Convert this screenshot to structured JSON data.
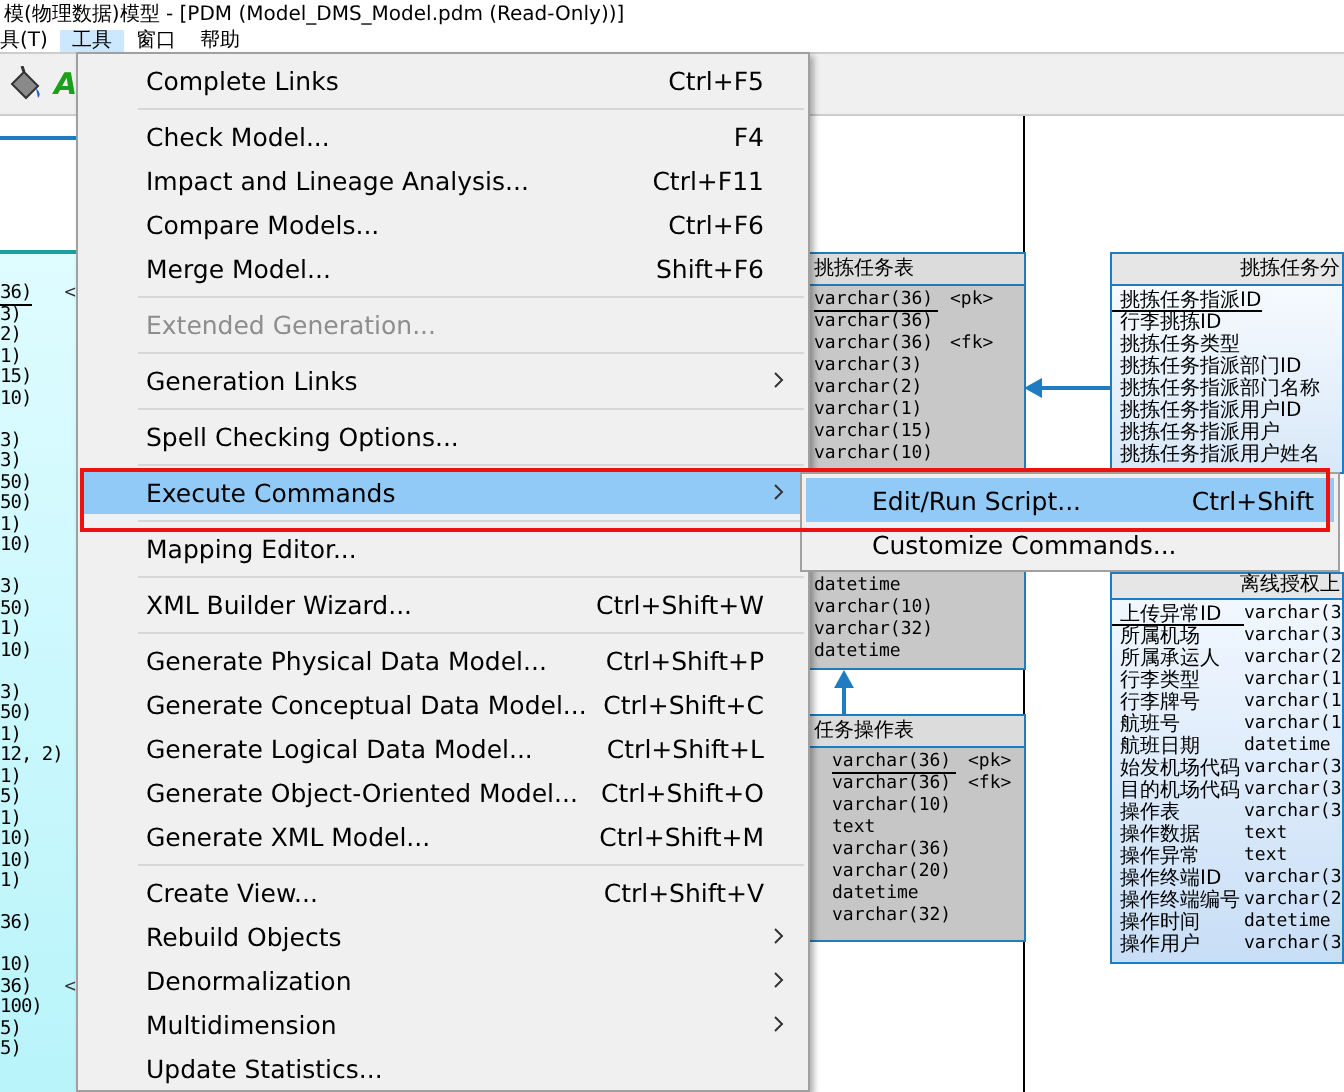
{
  "window": {
    "title": "模(物理数据)模型 - [PDM (Model_DMS_Model.pdm (Read-Only))]"
  },
  "menu_bar": [
    {
      "label": "具(T)",
      "selected": false
    },
    {
      "label": "工具",
      "selected": true
    },
    {
      "label": "窗口",
      "selected": false
    },
    {
      "label": "帮助",
      "selected": false
    }
  ],
  "toolbar": {
    "glyph": "A"
  },
  "menu": {
    "items": [
      {
        "kind": "item",
        "label": "Complete Links",
        "shortcut": "Ctrl+F5",
        "has_submenu": false,
        "disabled": false,
        "selected": false
      },
      {
        "kind": "separator"
      },
      {
        "kind": "item",
        "label": "Check Model...",
        "shortcut": "F4",
        "has_submenu": false,
        "disabled": false,
        "selected": false
      },
      {
        "kind": "item",
        "label": "Impact and Lineage Analysis...",
        "shortcut": "Ctrl+F11",
        "has_submenu": false,
        "disabled": false,
        "selected": false
      },
      {
        "kind": "item",
        "label": "Compare Models...",
        "shortcut": "Ctrl+F6",
        "has_submenu": false,
        "disabled": false,
        "selected": false
      },
      {
        "kind": "item",
        "label": "Merge Model...",
        "shortcut": "Shift+F6",
        "has_submenu": false,
        "disabled": false,
        "selected": false
      },
      {
        "kind": "separator"
      },
      {
        "kind": "item",
        "label": "Extended Generation...",
        "has_submenu": false,
        "disabled": true,
        "selected": false
      },
      {
        "kind": "separator"
      },
      {
        "kind": "item",
        "label": "Generation Links",
        "has_submenu": true,
        "disabled": false,
        "selected": false
      },
      {
        "kind": "separator"
      },
      {
        "kind": "item",
        "label": "Spell Checking Options...",
        "has_submenu": false,
        "disabled": false,
        "selected": false
      },
      {
        "kind": "separator"
      },
      {
        "kind": "item",
        "label": "Execute Commands",
        "has_submenu": true,
        "disabled": false,
        "selected": true
      },
      {
        "kind": "separator"
      },
      {
        "kind": "item",
        "label": "Mapping Editor...",
        "has_submenu": false,
        "disabled": false,
        "selected": false
      },
      {
        "kind": "separator"
      },
      {
        "kind": "item",
        "label": "XML Builder Wizard...",
        "shortcut": "Ctrl+Shift+W",
        "has_submenu": false,
        "disabled": false,
        "selected": false
      },
      {
        "kind": "separator"
      },
      {
        "kind": "item",
        "label": "Generate Physical Data Model...",
        "shortcut": "Ctrl+Shift+P",
        "has_submenu": false,
        "disabled": false,
        "selected": false
      },
      {
        "kind": "item",
        "label": "Generate Conceptual Data Model...",
        "shortcut": "Ctrl+Shift+C",
        "has_submenu": false,
        "disabled": false,
        "selected": false
      },
      {
        "kind": "item",
        "label": "Generate Logical Data Model...",
        "shortcut": "Ctrl+Shift+L",
        "has_submenu": false,
        "disabled": false,
        "selected": false
      },
      {
        "kind": "item",
        "label": "Generate Object-Oriented Model...",
        "shortcut": "Ctrl+Shift+O",
        "has_submenu": false,
        "disabled": false,
        "selected": false
      },
      {
        "kind": "item",
        "label": "Generate XML Model...",
        "shortcut": "Ctrl+Shift+M",
        "has_submenu": false,
        "disabled": false,
        "selected": false
      },
      {
        "kind": "separator"
      },
      {
        "kind": "item",
        "label": "Create View...",
        "shortcut": "Ctrl+Shift+V",
        "has_submenu": false,
        "disabled": false,
        "selected": false
      },
      {
        "kind": "item",
        "label": "Rebuild Objects",
        "has_submenu": true,
        "disabled": false,
        "selected": false
      },
      {
        "kind": "item",
        "label": "Denormalization",
        "has_submenu": true,
        "disabled": false,
        "selected": false
      },
      {
        "kind": "item",
        "label": "Multidimension",
        "has_submenu": true,
        "disabled": false,
        "selected": false
      },
      {
        "kind": "item",
        "label": "Update Statistics...",
        "has_submenu": false,
        "disabled": false,
        "selected": false
      }
    ]
  },
  "submenu": {
    "items": [
      {
        "label": "Edit/Run Script...",
        "shortcut": "Ctrl+Shift",
        "selected": true
      },
      {
        "label": "Customize Commands...",
        "selected": false
      }
    ]
  },
  "annotation": {
    "kind": "rectangle"
  },
  "diagram": {
    "partial_table": {
      "rows": [
        {
          "kind": "value",
          "text": "36)",
          "primary_key": true,
          "marker": "<"
        },
        {
          "kind": "value",
          "text": "3)",
          "primary_key": false
        },
        {
          "kind": "value",
          "text": "2)",
          "primary_key": false
        },
        {
          "kind": "value",
          "text": "1)",
          "primary_key": false
        },
        {
          "kind": "value",
          "text": "15)",
          "primary_key": false
        },
        {
          "kind": "value",
          "text": "10)",
          "primary_key": false
        },
        {
          "kind": "blank"
        },
        {
          "kind": "value",
          "text": "3)",
          "primary_key": false
        },
        {
          "kind": "value",
          "text": "3)",
          "primary_key": false
        },
        {
          "kind": "value",
          "text": "50)",
          "primary_key": false
        },
        {
          "kind": "value",
          "text": "50)",
          "primary_key": false
        },
        {
          "kind": "value",
          "text": "1)",
          "primary_key": false
        },
        {
          "kind": "value",
          "text": "10)",
          "primary_key": false
        },
        {
          "kind": "blank"
        },
        {
          "kind": "value",
          "text": "3)",
          "primary_key": false
        },
        {
          "kind": "value",
          "text": "50)",
          "primary_key": false
        },
        {
          "kind": "value",
          "text": "1)",
          "primary_key": false
        },
        {
          "kind": "value",
          "text": "10)",
          "primary_key": false
        },
        {
          "kind": "blank"
        },
        {
          "kind": "value",
          "text": "3)",
          "primary_key": false
        },
        {
          "kind": "value",
          "text": "50)",
          "primary_key": false
        },
        {
          "kind": "value",
          "text": "1)",
          "primary_key": false
        },
        {
          "kind": "value",
          "text": "12, 2)",
          "primary_key": false
        },
        {
          "kind": "value",
          "text": "1)",
          "primary_key": false
        },
        {
          "kind": "value",
          "text": "5)",
          "primary_key": false
        },
        {
          "kind": "value",
          "text": "1)",
          "primary_key": false
        },
        {
          "kind": "value",
          "text": "10)",
          "primary_key": false
        },
        {
          "kind": "value",
          "text": "10)",
          "primary_key": false
        },
        {
          "kind": "value",
          "text": "1)",
          "primary_key": false
        },
        {
          "kind": "blank"
        },
        {
          "kind": "value",
          "text": "36)",
          "primary_key": false
        },
        {
          "kind": "blank"
        },
        {
          "kind": "value",
          "text": "10)",
          "primary_key": false
        },
        {
          "kind": "value",
          "text": "36)",
          "primary_key": false,
          "marker": "<"
        },
        {
          "kind": "value",
          "text": "100)",
          "primary_key": false
        },
        {
          "kind": "value",
          "text": "5)",
          "primary_key": false
        },
        {
          "kind": "value",
          "text": "5)",
          "primary_key": false
        }
      ]
    },
    "tables": [
      {
        "title": "挑拣任务表",
        "rows": [
          {
            "kind": "value",
            "type": "varchar(36)",
            "key_label": "<pk>",
            "primary_key": true
          },
          {
            "kind": "value",
            "type": "varchar(36)",
            "primary_key": false
          },
          {
            "kind": "value",
            "type": "varchar(36)",
            "key_label": "<fk>",
            "primary_key": false
          },
          {
            "kind": "value",
            "type": "varchar(3)",
            "primary_key": false
          },
          {
            "kind": "value",
            "type": "varchar(2)",
            "primary_key": false
          },
          {
            "kind": "value",
            "type": "varchar(1)",
            "primary_key": false
          },
          {
            "kind": "value",
            "type": "varchar(15)",
            "primary_key": false
          },
          {
            "kind": "value",
            "type": "varchar(10)",
            "primary_key": false
          },
          {
            "kind": "covered"
          },
          {
            "kind": "covered"
          },
          {
            "kind": "covered"
          },
          {
            "kind": "covered"
          },
          {
            "kind": "covered"
          },
          {
            "kind": "value",
            "type": "datetime",
            "primary_key": false
          },
          {
            "kind": "value",
            "type": "varchar(10)",
            "primary_key": false
          },
          {
            "kind": "value",
            "type": "varchar(32)",
            "primary_key": false
          },
          {
            "kind": "value",
            "type": "datetime",
            "primary_key": false
          }
        ]
      },
      {
        "title": "挑拣任务分",
        "rows": [
          {
            "kind": "value",
            "name": "挑拣任务指派ID",
            "primary_key": true
          },
          {
            "kind": "value",
            "name": "行李挑拣ID",
            "primary_key": false
          },
          {
            "kind": "value",
            "name": "挑拣任务类型",
            "primary_key": false
          },
          {
            "kind": "value",
            "name": "挑拣任务指派部门ID",
            "primary_key": false
          },
          {
            "kind": "value",
            "name": "挑拣任务指派部门名称",
            "primary_key": false
          },
          {
            "kind": "value",
            "name": "挑拣任务指派用户ID",
            "primary_key": false
          },
          {
            "kind": "value",
            "name": "挑拣任务指派用户",
            "primary_key": false
          },
          {
            "kind": "value",
            "name": "挑拣任务指派用户姓名",
            "primary_key": false
          }
        ]
      },
      {
        "title": "离线授权上",
        "rows": [
          {
            "kind": "value",
            "name": "上传异常ID",
            "type": "varchar(3",
            "primary_key": true
          },
          {
            "kind": "value",
            "name": "所属机场",
            "type": "varchar(3",
            "primary_key": false
          },
          {
            "kind": "value",
            "name": "所属承运人",
            "type": "varchar(2",
            "primary_key": false
          },
          {
            "kind": "value",
            "name": "行李类型",
            "type": "varchar(1",
            "primary_key": false
          },
          {
            "kind": "value",
            "name": "行李牌号",
            "type": "varchar(1",
            "primary_key": false
          },
          {
            "kind": "value",
            "name": "航班号",
            "type": "varchar(1",
            "primary_key": false
          },
          {
            "kind": "value",
            "name": "航班日期",
            "type": "datetime",
            "primary_key": false
          },
          {
            "kind": "value",
            "name": "始发机场代码",
            "type": "varchar(3",
            "primary_key": false
          },
          {
            "kind": "value",
            "name": "目的机场代码",
            "type": "varchar(3",
            "primary_key": false
          },
          {
            "kind": "value",
            "name": "操作表",
            "type": "varchar(3",
            "primary_key": false
          },
          {
            "kind": "value",
            "name": "操作数据",
            "type": "text",
            "primary_key": false
          },
          {
            "kind": "value",
            "name": "操作异常",
            "type": "text",
            "primary_key": false
          },
          {
            "kind": "value",
            "name": "操作终端ID",
            "type": "varchar(3",
            "primary_key": false
          },
          {
            "kind": "value",
            "name": "操作终端编号",
            "type": "varchar(2",
            "primary_key": false
          },
          {
            "kind": "value",
            "name": "操作时间",
            "type": "datetime",
            "primary_key": false
          },
          {
            "kind": "value",
            "name": "操作用户",
            "type": "varchar(3",
            "primary_key": false
          }
        ]
      },
      {
        "title": "任务操作表",
        "rows": [
          {
            "kind": "value",
            "type": "varchar(36)",
            "key_label": "<pk>",
            "primary_key": true
          },
          {
            "kind": "value",
            "type": "varchar(36)",
            "key_label": "<fk>",
            "primary_key": false
          },
          {
            "kind": "value",
            "type": "varchar(10)",
            "primary_key": false
          },
          {
            "kind": "value",
            "type": "text",
            "primary_key": false
          },
          {
            "kind": "value",
            "type": "varchar(36)",
            "primary_key": false
          },
          {
            "kind": "value",
            "type": "varchar(20)",
            "primary_key": false
          },
          {
            "kind": "value",
            "type": "datetime",
            "primary_key": false
          },
          {
            "kind": "value",
            "type": "varchar(32)",
            "primary_key": false
          }
        ]
      }
    ]
  }
}
